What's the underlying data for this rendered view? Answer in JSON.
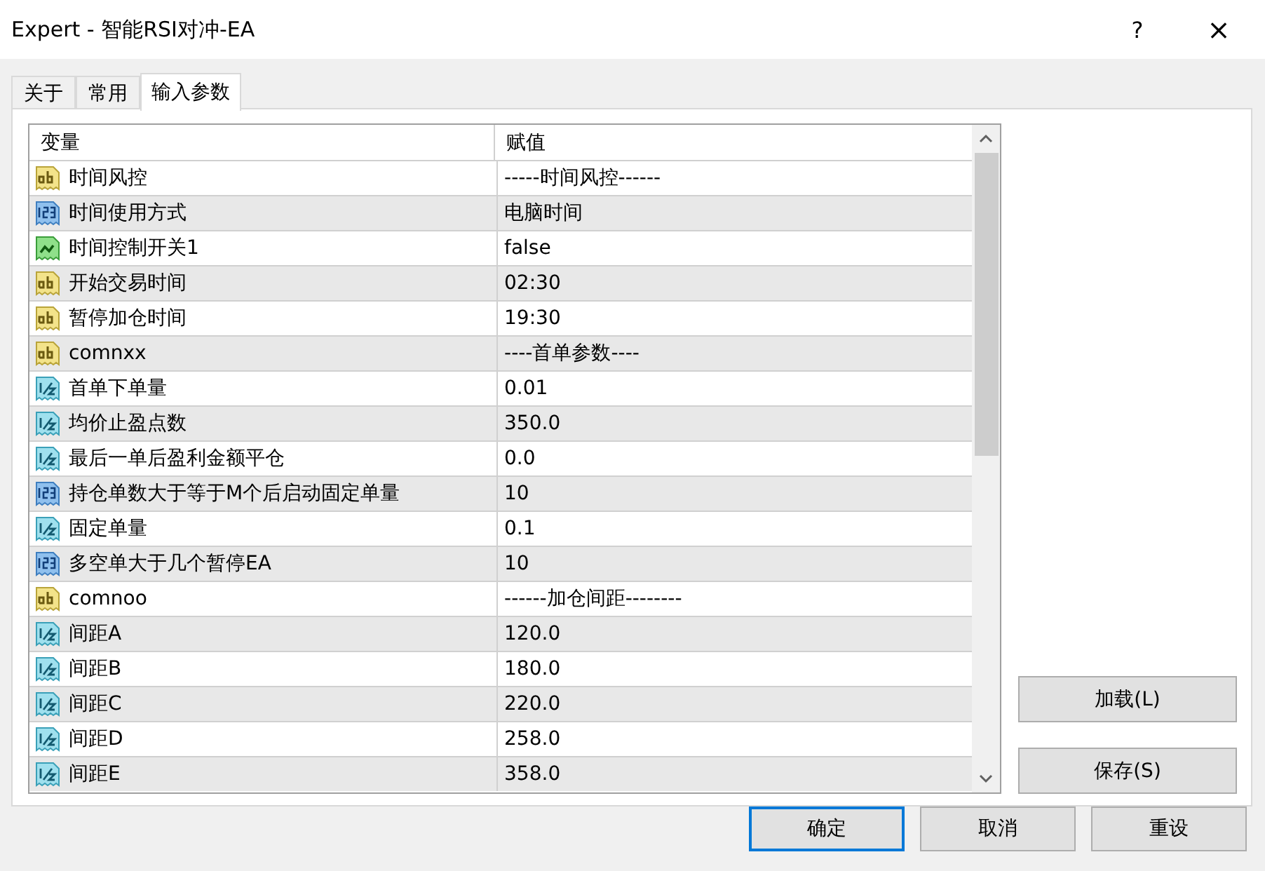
{
  "window": {
    "title": "Expert - 智能RSI对冲-EA",
    "help": "?",
    "close": "×"
  },
  "tabs": [
    {
      "label": "关于",
      "selected": false
    },
    {
      "label": "常用",
      "selected": false
    },
    {
      "label": "输入参数",
      "selected": true
    }
  ],
  "table": {
    "columns": [
      "变量",
      "赋值"
    ],
    "rows": [
      {
        "kind": "string",
        "name": "时间风控",
        "value": "-----时间风控------"
      },
      {
        "kind": "integer",
        "name": "时间使用方式",
        "value": "电脑时间"
      },
      {
        "kind": "bool",
        "name": "时间控制开关1",
        "value": "false"
      },
      {
        "kind": "string",
        "name": "开始交易时间",
        "value": "02:30"
      },
      {
        "kind": "string",
        "name": "暂停加仓时间",
        "value": "19:30"
      },
      {
        "kind": "string",
        "name": "comnxx",
        "value": "----首单参数----"
      },
      {
        "kind": "double",
        "name": "首单下单量",
        "value": "0.01"
      },
      {
        "kind": "double",
        "name": "均价止盈点数",
        "value": "350.0"
      },
      {
        "kind": "double",
        "name": "最后一单后盈利金额平仓",
        "value": "0.0"
      },
      {
        "kind": "integer",
        "name": "持仓单数大于等于M个后启动固定单量",
        "value": "10"
      },
      {
        "kind": "double",
        "name": "固定单量",
        "value": "0.1"
      },
      {
        "kind": "integer",
        "name": "多空单大于几个暂停EA",
        "value": "10"
      },
      {
        "kind": "string",
        "name": "comnoo",
        "value": "------加仓间距--------"
      },
      {
        "kind": "double",
        "name": "间距A",
        "value": "120.0"
      },
      {
        "kind": "double",
        "name": "间距B",
        "value": "180.0"
      },
      {
        "kind": "double",
        "name": "间距C",
        "value": "220.0"
      },
      {
        "kind": "double",
        "name": "间距D",
        "value": "258.0"
      },
      {
        "kind": "double",
        "name": "间距E",
        "value": "358.0"
      }
    ]
  },
  "side_buttons": [
    "加载(L)",
    "保存(S)"
  ],
  "buttons": [
    {
      "label": "确定",
      "default": true
    },
    {
      "label": "取消",
      "default": false
    },
    {
      "label": "重设",
      "default": false
    }
  ]
}
